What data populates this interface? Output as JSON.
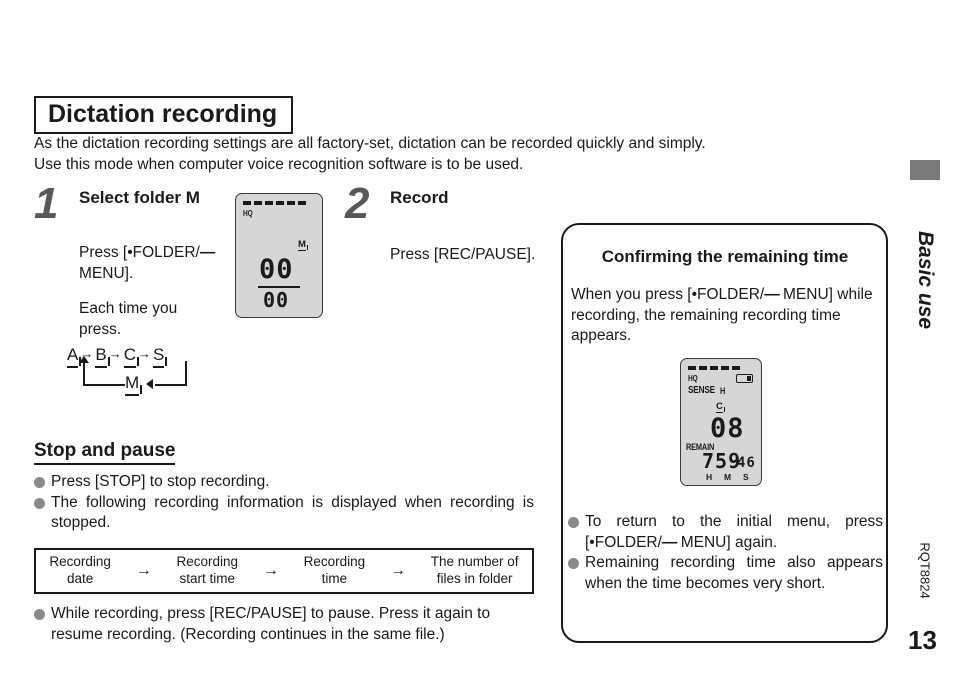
{
  "document": {
    "section_tab_label": "Basic use",
    "doc_code": "RQT8824",
    "page_number": "13"
  },
  "heading": {
    "title": "Dictation recording"
  },
  "intro": {
    "line1": "As the dictation recording settings are all factory-set, dictation can be recorded quickly and simply.",
    "line2": "Use this mode when computer voice recognition software is to be used."
  },
  "steps": [
    {
      "number": "1",
      "heading": "Select folder M",
      "body1_pre": "Press [•FOLDER/",
      "body1_minus": "—",
      "body1_post": " MENU].",
      "body2": "Each time you press."
    },
    {
      "number": "2",
      "heading": "Record",
      "body1": "Press [REC/PAUSE]."
    }
  ],
  "folder_sequence": {
    "items": [
      "A",
      "B",
      "C",
      "S"
    ],
    "arrow": "→",
    "loop_item": "M"
  },
  "lcd_step1": {
    "mode_label": "HQ",
    "folder_label": "M",
    "primary_digits": "00",
    "secondary_digits": "00",
    "dash_count": 6
  },
  "lcd_remaining": {
    "mode_label": "HQ",
    "sense_label": "SENSE",
    "sense_level": "H",
    "battery_icon": "battery-icon",
    "folder_label": "C",
    "file_number": "08",
    "remain_label": "REMAIN",
    "time_hm": "759",
    "time_s": "46",
    "unit_h": "H",
    "unit_m": "M",
    "unit_s": "S",
    "dash_count": 5
  },
  "stop_and_pause": {
    "heading": "Stop and pause",
    "bullets_top": [
      "Press [STOP] to stop recording.",
      "The following recording information is displayed when recording is stopped."
    ],
    "bullets_bottom": [
      "While recording, press [REC/PAUSE] to pause. Press it again to resume recording. (Recording continues in the same file.)"
    ]
  },
  "flow_table": {
    "arrow": "→",
    "cells": [
      "Recording\ndate",
      "Recording\nstart time",
      "Recording\ntime",
      "The number of\nfiles in folder"
    ],
    "cell1_line1": "Recording",
    "cell1_line2": "date",
    "cell2_line1": "Recording",
    "cell2_line2": "start time",
    "cell3_line1": "Recording",
    "cell3_line2": "time",
    "cell4_line1": "The number of",
    "cell4_line2": "files in folder"
  },
  "panel": {
    "title": "Confirming the remaining time",
    "paragraph_pre": "When you press [•FOLDER/",
    "paragraph_minus": "—",
    "paragraph_post": " MENU] while recording, the remaining recording time appears.",
    "bullet1_pre": "To return to the initial menu, press [•FOLDER/",
    "bullet1_minus": "—",
    "bullet1_post": " MENU] again.",
    "bullet2": "Remaining recording time also appears when the time becomes very short."
  },
  "colors": {
    "step_number": "#58585a",
    "bullet": "#8a8a8a",
    "lcd_background": "#d6d6d6",
    "tab_block": "#7a7a7a",
    "text": "#1a1a1a"
  }
}
